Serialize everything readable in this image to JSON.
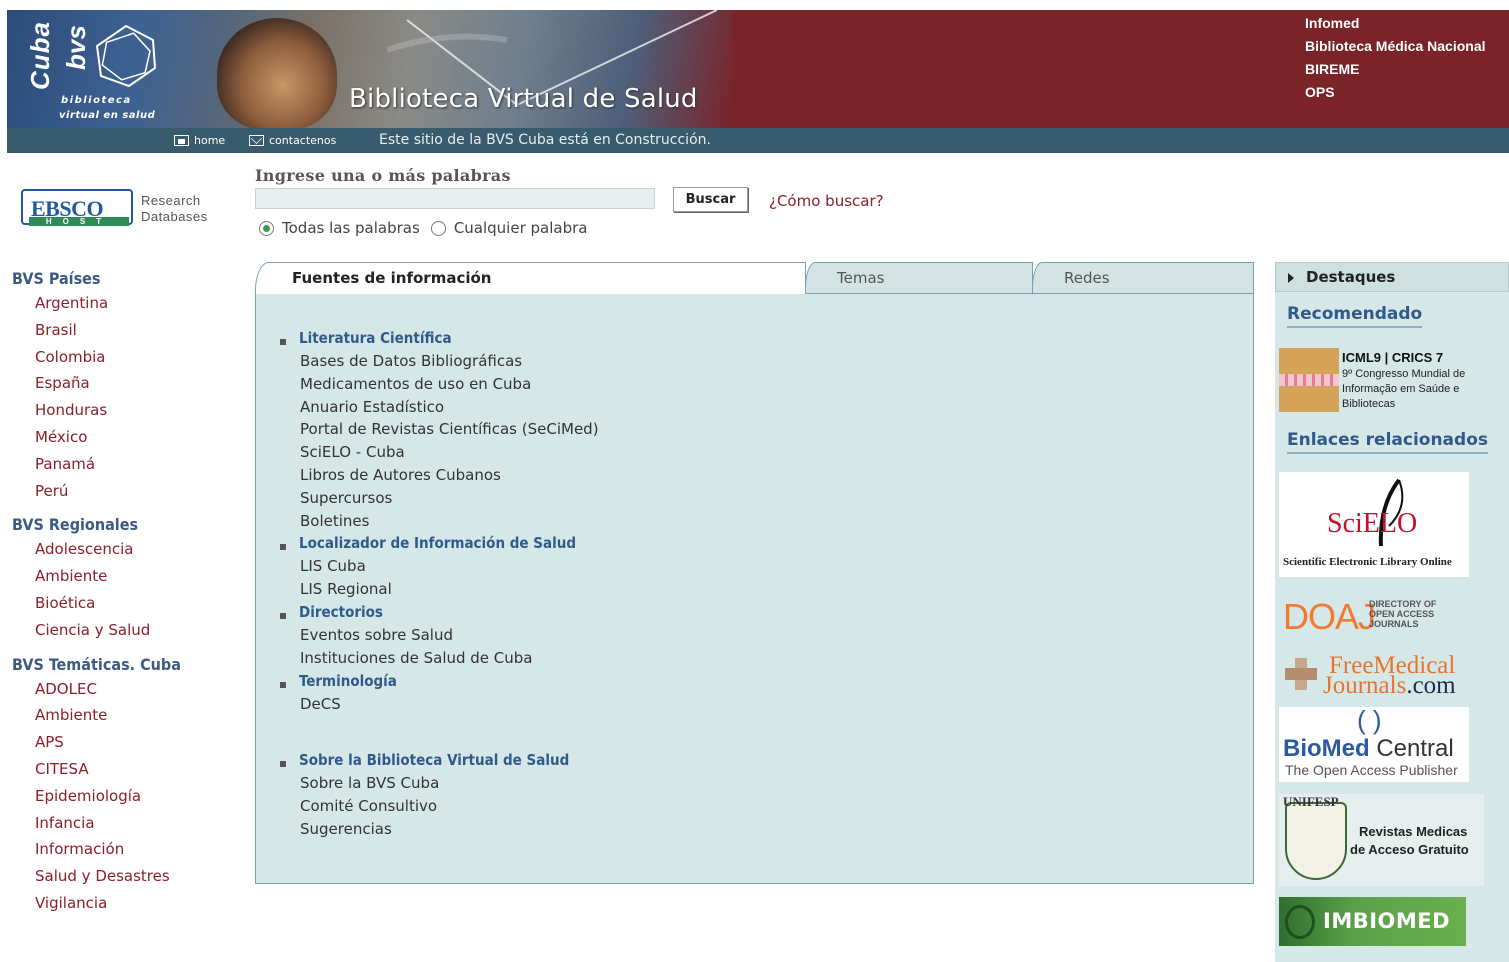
{
  "header": {
    "logo_word_1": "Cuba",
    "logo_word_2": "bvs",
    "logo_tagline_1": "biblioteca",
    "logo_tagline_2": "virtual en salud",
    "site_title": "Biblioteca Virtual de Salud",
    "partner_links": [
      "Infomed",
      "Biblioteca Médica Nacional",
      "BIREME",
      "OPS"
    ],
    "colors": {
      "header_bg": "#7a2328",
      "nav_bg": "#385c6e"
    }
  },
  "nav": {
    "home_label": "home",
    "contact_label": "contactenos",
    "notice": "Este sitio de la BVS Cuba está en Construcción."
  },
  "ebsco": {
    "brand": "EBSCO",
    "host": "HOST",
    "line1": "Research",
    "line2": "Databases"
  },
  "search": {
    "label": "Ingrese una o más palabras",
    "input_value": "",
    "button_label": "Buscar",
    "help_link": "¿Cómo buscar?",
    "option_all": "Todas las palabras",
    "option_any": "Cualquier palabra",
    "selected_option": "Todas las palabras"
  },
  "sidebar": {
    "groups": [
      {
        "title": "BVS Países",
        "items": [
          "Argentina",
          "Brasil",
          "Colombia",
          "España",
          "Honduras",
          "México",
          "Panamá",
          "Perú"
        ]
      },
      {
        "title": "BVS Regionales",
        "items": [
          "Adolescencia",
          "Ambiente",
          "Bioética",
          "Ciencia y Salud"
        ]
      },
      {
        "title": "BVS Temáticas. Cuba",
        "items": [
          "ADOLEC",
          "Ambiente",
          "APS",
          "CITESA",
          "Epidemiología",
          "Infancia",
          "Información",
          "Salud y Desastres",
          "Vigilancia"
        ]
      }
    ]
  },
  "tabs": [
    "Fuentes de información",
    "Temas",
    "Redes"
  ],
  "active_tab": "Fuentes de información",
  "sections": [
    {
      "title": "Literatura Científica",
      "items": [
        "Bases de Datos Bibliográficas",
        "Medicamentos de uso en Cuba",
        "Anuario Estadístico",
        "Portal de Revistas Científicas (SeCiMed)",
        "SciELO - Cuba",
        "Libros de Autores Cubanos",
        "Supercursos",
        "Boletines"
      ]
    },
    {
      "title": "Localizador de Información de Salud",
      "items": [
        "LIS Cuba",
        "LIS Regional"
      ]
    },
    {
      "title": "Directorios",
      "items": [
        "Eventos sobre Salud",
        "Instituciones de Salud de Cuba"
      ]
    },
    {
      "title": "Terminología",
      "items": [
        "DeCS"
      ]
    },
    {
      "title": "Sobre la Biblioteca Virtual de Salud",
      "items": [
        "Sobre la BVS Cuba",
        "Comité Consultivo",
        "Sugerencias"
      ]
    }
  ],
  "right": {
    "destaques": "Destaques",
    "recomendado": "Recomendado",
    "icml_title": "ICML9 | CRICS 7",
    "icml_sub": "9º Congresso Mundial de Informação em Saúde e Bibliotecas",
    "enlaces": "Enlaces relacionados",
    "scielo_mark": "SciELO",
    "scielo_sub": "Scientific Electronic Library Online",
    "doaj": "DOAJ",
    "doaj_sub": "DIRECTORY OF OPEN ACCESS JOURNALS",
    "fmj_1": "FreeMedical",
    "fmj_2": "Journals",
    "fmj_3": ".com",
    "biomed_1": "BioMed",
    "biomed_2": "Central",
    "biomed_sub": "The Open Access Publisher",
    "unifesp": "UNIFESP",
    "revistas_1": "Revistas Medicas",
    "revistas_2": "de Acceso Gratuito",
    "imbiomed": "IMBIOMED"
  }
}
